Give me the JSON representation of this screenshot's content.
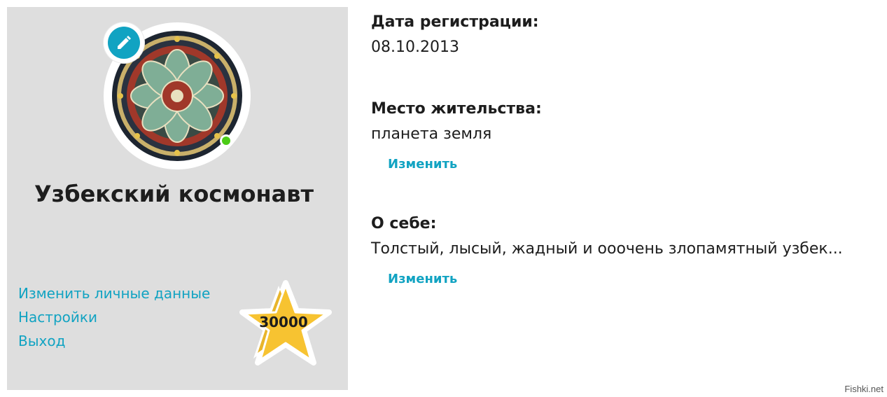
{
  "profile": {
    "username": "Узбекский космонавт",
    "links": [
      {
        "label": "Изменить личные данные"
      },
      {
        "label": "Настройки"
      },
      {
        "label": "Выход"
      }
    ],
    "rating": "30000",
    "status": "online"
  },
  "info": {
    "registration": {
      "label": "Дата регистрации:",
      "value": "08.10.2013"
    },
    "residence": {
      "label": "Место жительства:",
      "value": "планета земля",
      "edit_label": "Изменить"
    },
    "about": {
      "label": "О себе:",
      "value": "Толстый, лысый, жадный и ооочень злопамятный узбек...",
      "edit_label": "Изменить"
    }
  },
  "watermark": "Fishki.net",
  "colors": {
    "accent": "#11a3c2",
    "online": "#4ccc17",
    "card_bg": "#dedede",
    "star": "#f7c331"
  }
}
